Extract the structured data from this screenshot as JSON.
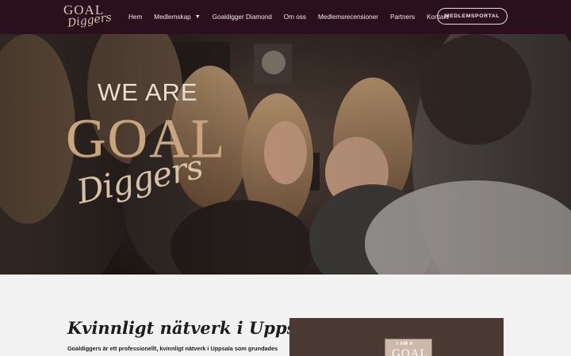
{
  "nav": {
    "logo_top": "GOAL",
    "logo_bottom": "Diggers",
    "links": [
      {
        "label": "Hem"
      },
      {
        "label": "Medlemskap",
        "has_dropdown": true
      },
      {
        "label": "Goaldigger Diamond"
      },
      {
        "label": "Om oss"
      },
      {
        "label": "Medlemsrecensioner"
      },
      {
        "label": "Partners"
      },
      {
        "label": "Kontakt"
      }
    ],
    "portal_button": "MEDLEMSPORTAL",
    "dropdown_icon": "chevron-down-icon",
    "background_color": "#2a0f1c"
  },
  "hero": {
    "we_are": "WE ARE",
    "goal": "GOAL",
    "diggers": "Diggers",
    "accent_color": "#c9a57e"
  },
  "section": {
    "title": "Kvinnligt nätverk i Uppsala",
    "intro": "Goaldiggers är ett professionellt, kvinnligt nätverk i Uppsala som grundades",
    "photo_text_1": "I AM A",
    "photo_text_2": "GOAL"
  }
}
